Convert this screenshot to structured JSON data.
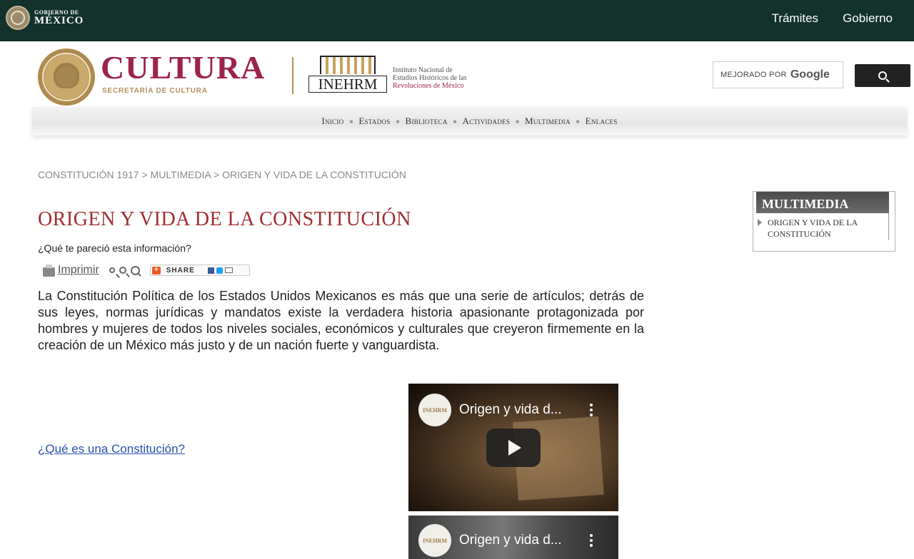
{
  "gov_bar": {
    "logo_small": "GOBIERNO DE",
    "logo_big": "MÉXICO",
    "nav": [
      "Trámites",
      "Gobierno"
    ]
  },
  "header": {
    "cultura_title": "CULTURA",
    "cultura_sub": "SECRETARÍA DE CULTURA",
    "inehrm_word": "INEHRM",
    "inehrm_desc_line1": "Instituto Nacional de",
    "inehrm_desc_line2": "Estudios Históricos de las",
    "inehrm_desc_line3": "Revoluciones de México"
  },
  "search": {
    "label": "MEJORADO POR",
    "brand": "Google",
    "icon": "search-icon"
  },
  "nav": {
    "items": [
      "Inicio",
      "Estados",
      "Biblioteca",
      "Actividades",
      "Multimedia",
      "Enlaces"
    ],
    "separator": "■"
  },
  "breadcrumb": {
    "items": [
      "CONSTITUCIÓN 1917",
      "MULTIMEDIA",
      "ORIGEN Y VIDA DE LA CONSTITUCIÓN"
    ],
    "sep": " > "
  },
  "content": {
    "title": "ORIGEN Y VIDA DE LA CONSTITUCIÓN",
    "feedback": "¿Qué te pareció esta información?",
    "print_label": "Imprimir",
    "share_label": "SHARE",
    "intro": "La Constitución Política de los Estados Unidos Mexicanos es más que una serie de artículos; detrás de sus leyes, normas jurídicas y mandatos existe la verdadera historia apasionante protagonizada por hombres y mujeres de todos los niveles sociales, económicos y culturales que creyeron firmemente en la creación de un México más justo y de un nación fuerte y vanguardista.",
    "link_question": "¿Qué es una Constitución?"
  },
  "videos": [
    {
      "title": "Origen y vida d...",
      "channel": "INEHRM"
    },
    {
      "title": "Origen y vida d...",
      "channel": "INEHRM"
    }
  ],
  "sidebar": {
    "heading": "MULTIMEDIA",
    "items": [
      {
        "line1": "ORIGEN Y VIDA DE LA",
        "line2": "CONSTITUCIÓN"
      }
    ]
  },
  "colors": {
    "gov_bar": "#13322b",
    "accent": "#9d2449",
    "gold": "#b38e5d",
    "title": "#a02e2e",
    "link": "#2a4fb0"
  }
}
